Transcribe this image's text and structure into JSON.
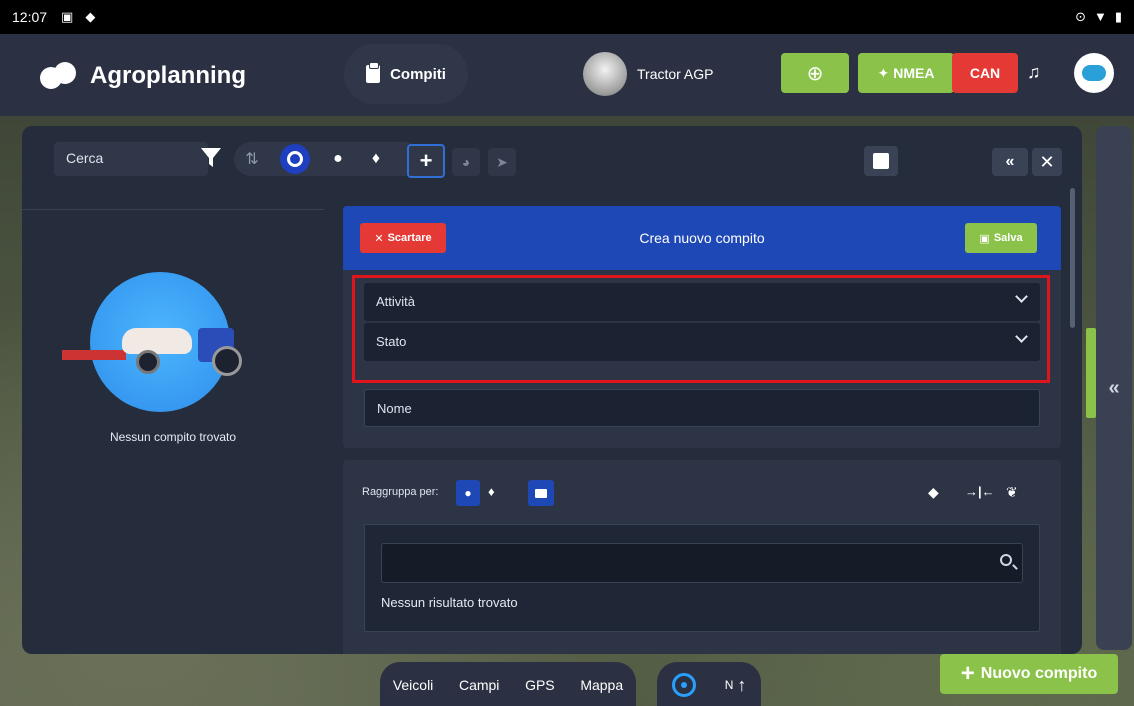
{
  "status_bar": {
    "time": "12:07"
  },
  "app": {
    "brand": "Agroplanning",
    "tab_label": "Compiti",
    "vehicle_name": "Tractor AGP",
    "nmea_label": "NMEA",
    "can_label": "CAN"
  },
  "toolbar": {
    "search_placeholder": "Cerca"
  },
  "empty_state": {
    "message": "Nessun compito trovato"
  },
  "form": {
    "title": "Crea nuovo compito",
    "discard_label": "Scartare",
    "save_label": "Salva",
    "activity_placeholder": "Attività",
    "status_placeholder": "Stato",
    "name_placeholder": "Nome"
  },
  "group": {
    "label": "Raggruppa per:",
    "no_results": "Nessun risultato trovato"
  },
  "bottom_nav": {
    "items": [
      "Veicoli",
      "Campi",
      "GPS",
      "Mappa"
    ],
    "north_label": "N"
  },
  "fab": {
    "label": "Nuovo compito"
  },
  "colors": {
    "accent_green": "#8bc34a",
    "accent_red": "#e53935",
    "accent_blue": "#1e48b5",
    "highlight_red": "#e0141b"
  }
}
